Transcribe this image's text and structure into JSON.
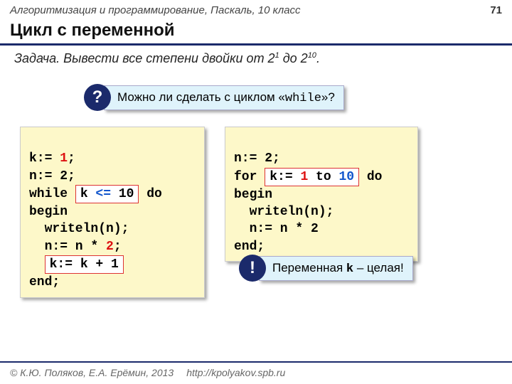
{
  "header": {
    "course": "Алгоритмизация и программирование, Паскаль, 10 класс",
    "page": "71"
  },
  "title": "Цикл с переменной",
  "task": {
    "label": "Задача",
    "text_a": ". Вывести все степени двойки от 2",
    "sup_a": "1",
    "text_b": " до 2",
    "sup_b": "10",
    "text_c": "."
  },
  "q_callout": {
    "mark": "?",
    "text_a": "Можно ли сделать с циклом «",
    "mono": "while",
    "text_b": "»?"
  },
  "code_left": {
    "l1a": "k:= ",
    "l1red": "1",
    "l1b": ";",
    "l2": "n:= 2;",
    "l3a": "while ",
    "l3box_a": "k ",
    "l3box_b": "<=",
    "l3box_c": " 10",
    "l3b": " do",
    "l4": "begin",
    "l5": "  writeln(n);",
    "l6a": "  n:= n * ",
    "l6red": "2",
    "l6b": ";",
    "l7box": "k:= k + 1",
    "l8": "end;"
  },
  "code_right": {
    "l1": "n:= 2;",
    "l2a": "for ",
    "l2box_a": "k:= ",
    "l2box_b": "1",
    "l2box_c": " to ",
    "l2box_d": "10",
    "l2b": " do",
    "l3": "begin",
    "l4": "  writeln(n);",
    "l5": "  n:= n * 2",
    "l6": "end;"
  },
  "bang_callout": {
    "mark": "!",
    "text_a": "Переменная ",
    "mono": "k",
    "text_b": " – целая!"
  },
  "footer": {
    "credit": "© К.Ю. Поляков, Е.А. Ерёмин, 2013",
    "url": "http://kpolyakov.spb.ru"
  }
}
